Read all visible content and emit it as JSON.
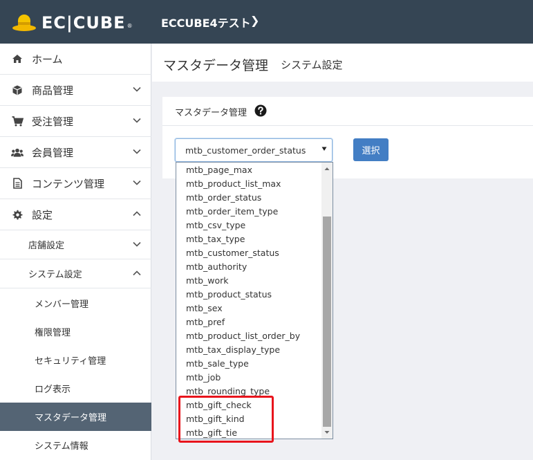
{
  "header": {
    "logo_text": "EC|CUBE",
    "logo_registered": "®",
    "shop_name": "ECCUBE4テスト",
    "shop_chevron": "❯",
    "background": "#354554"
  },
  "sidebar": {
    "items": [
      {
        "label": "ホーム",
        "icon": "home-icon"
      },
      {
        "label": "商品管理",
        "icon": "box-icon"
      },
      {
        "label": "受注管理",
        "icon": "cart-icon"
      },
      {
        "label": "会員管理",
        "icon": "users-icon"
      },
      {
        "label": "コンテンツ管理",
        "icon": "document-icon"
      },
      {
        "label": "設定",
        "icon": "gear-icon"
      }
    ],
    "sub_items": [
      {
        "label": "店舗設定"
      },
      {
        "label": "システム設定"
      }
    ],
    "leaf_items": [
      {
        "label": "メンバー管理",
        "active": false
      },
      {
        "label": "権限管理",
        "active": false
      },
      {
        "label": "セキュリティ管理",
        "active": false
      },
      {
        "label": "ログ表示",
        "active": false
      },
      {
        "label": "マスタデータ管理",
        "active": true
      },
      {
        "label": "システム情報",
        "active": false
      }
    ],
    "active_color": "#546474"
  },
  "main": {
    "title": "マスタデータ管理",
    "subtitle": "システム設定",
    "card_title": "マスタデータ管理",
    "select": {
      "value": "mtb_customer_order_status",
      "options": [
        "mtb_page_max",
        "mtb_product_list_max",
        "mtb_order_status",
        "mtb_order_item_type",
        "mtb_csv_type",
        "mtb_tax_type",
        "mtb_customer_status",
        "mtb_authority",
        "mtb_work",
        "mtb_product_status",
        "mtb_sex",
        "mtb_pref",
        "mtb_product_list_order_by",
        "mtb_tax_display_type",
        "mtb_sale_type",
        "mtb_job",
        "mtb_rounding_type",
        "mtb_gift_check",
        "mtb_gift_kind",
        "mtb_gift_tie"
      ]
    },
    "select_button_label": "選択",
    "button_color": "#437ec4",
    "highlight_color": "#e8141c"
  }
}
